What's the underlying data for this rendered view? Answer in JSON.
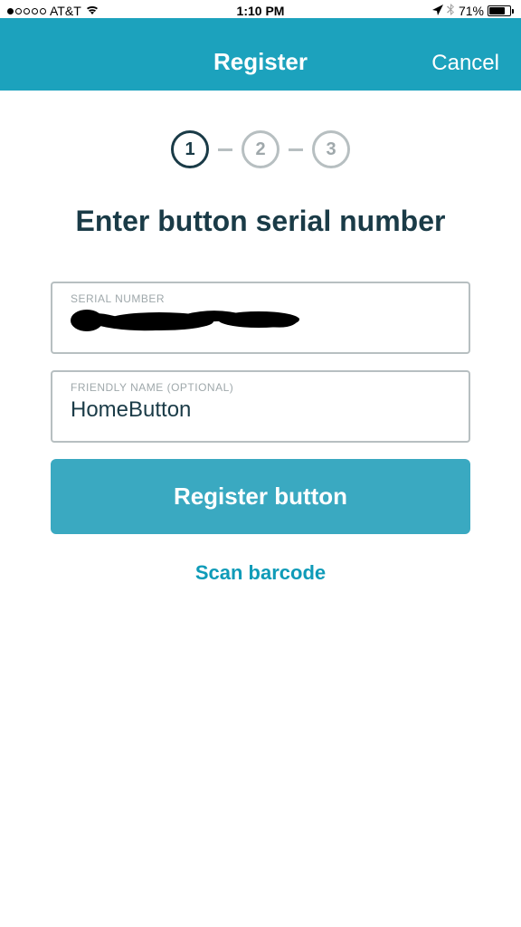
{
  "status_bar": {
    "carrier": "AT&T",
    "time": "1:10 PM",
    "battery_percent": "71%"
  },
  "header": {
    "title": "Register",
    "cancel": "Cancel"
  },
  "steps": {
    "s1": "1",
    "s2": "2",
    "s3": "3"
  },
  "page_title": "Enter button serial number",
  "fields": {
    "serial": {
      "label": "SERIAL NUMBER",
      "value": ""
    },
    "friendly": {
      "label": "FRIENDLY NAME (OPTIONAL)",
      "value": "HomeButton"
    }
  },
  "actions": {
    "register": "Register button",
    "scan": "Scan barcode"
  }
}
